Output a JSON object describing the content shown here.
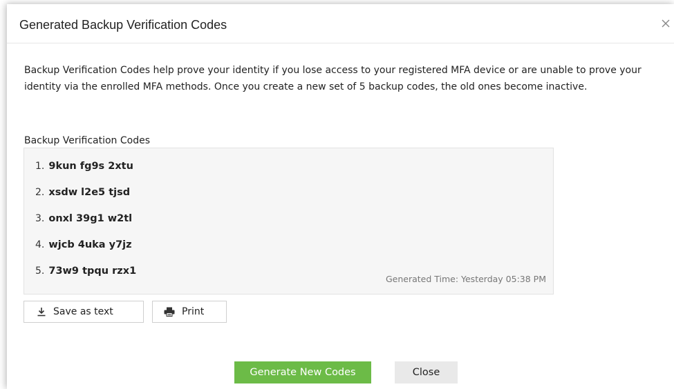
{
  "dialog": {
    "title": "Generated Backup Verification Codes",
    "description": "Backup Verification Codes help prove your identity if you lose access to your registered MFA device or are unable to prove your identity via the enrolled MFA methods. Once you create a new set of 5 backup codes, the old ones become inactive.",
    "codes_label": "Backup Verification Codes",
    "codes": [
      {
        "num": "1.",
        "code": "9kun fg9s 2xtu"
      },
      {
        "num": "2.",
        "code": "xsdw l2e5 tjsd"
      },
      {
        "num": "3.",
        "code": "onxl 39g1 w2tl"
      },
      {
        "num": "4.",
        "code": "wjcb 4uka y7jz"
      },
      {
        "num": "5.",
        "code": "73w9 tpqu rzx1"
      }
    ],
    "generated_time": "Generated Time: Yesterday 05:38 PM",
    "save_label": "Save as text",
    "print_label": "Print",
    "generate_label": "Generate New Codes",
    "close_label": "Close"
  },
  "icons": {
    "close": "close-icon",
    "download": "download-icon",
    "print": "printer-icon"
  },
  "colors": {
    "primary_button": "#6cbb47",
    "secondary_button": "#e9e9e9",
    "codes_background": "#f6f6f6"
  }
}
